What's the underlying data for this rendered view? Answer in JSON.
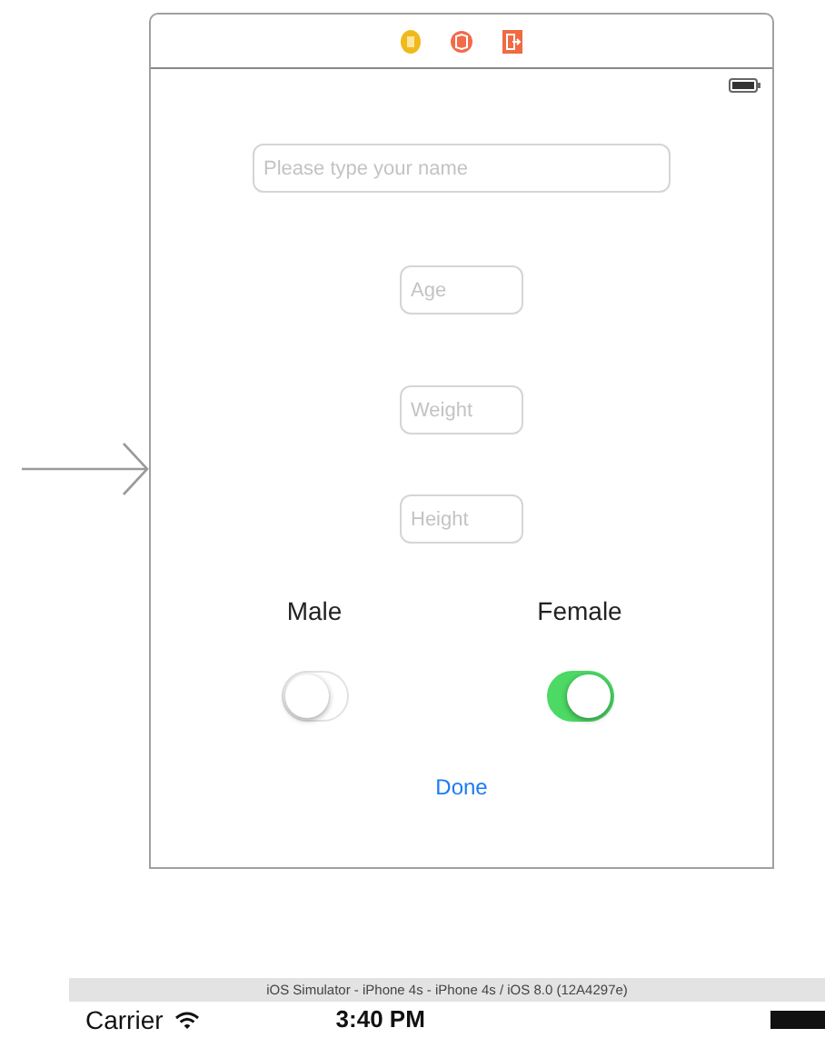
{
  "scene": {
    "fields": [
      {
        "placeholder": "Please type your name",
        "kind": "wide"
      },
      {
        "placeholder": "Age",
        "kind": "short"
      },
      {
        "placeholder": "Weight",
        "kind": "short"
      },
      {
        "placeholder": "Height",
        "kind": "short"
      }
    ],
    "toggles": [
      {
        "label": "Male",
        "on": false
      },
      {
        "label": "Female",
        "on": true
      }
    ],
    "button": "Done"
  },
  "simulator": {
    "title": "iOS Simulator - iPhone 4s - iPhone 4s / iOS 8.0 (12A4297e)",
    "carrier": "Carrier",
    "time": "3:40 PM"
  }
}
